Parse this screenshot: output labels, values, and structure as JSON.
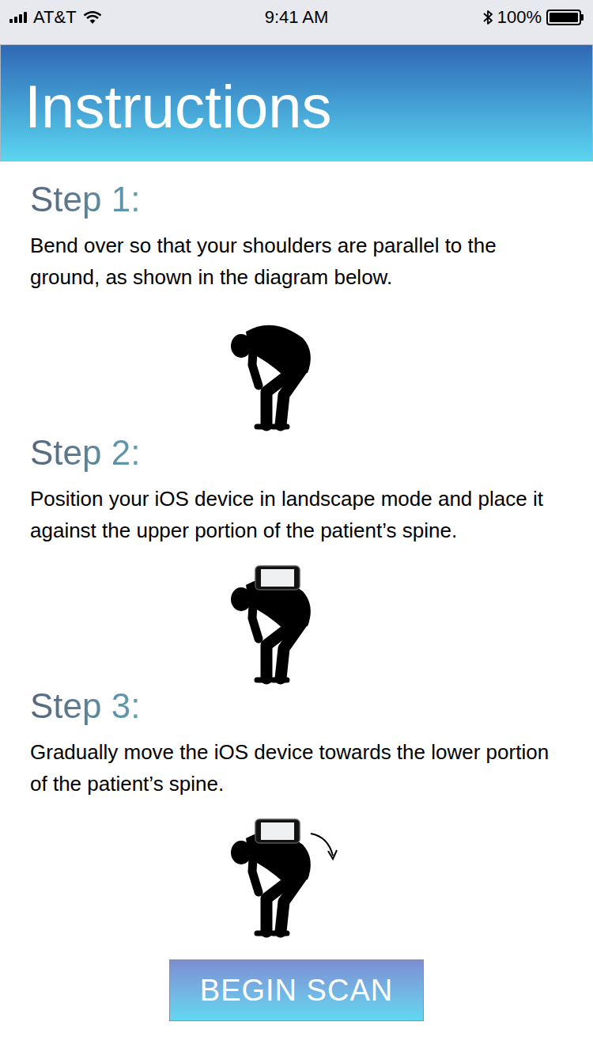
{
  "status_bar": {
    "carrier": "AT&T",
    "signal_level": 1,
    "wifi": true,
    "time": "9:41 AM",
    "bluetooth": true,
    "battery": "100%",
    "battery_level": 1
  },
  "header": {
    "title": "Instructions"
  },
  "steps": [
    {
      "heading": "Step 1:",
      "text": "Bend over so that your shoulders are parallel to the ground, as shown in the diagram below.",
      "kind": "bend"
    },
    {
      "heading": "Step 2:",
      "text": "Position your iOS device in landscape mode and place it against the upper portion of the patient’s spine.",
      "kind": "phone"
    },
    {
      "heading": "Step 3:",
      "text": "Gradually move the iOS device towards the lower portion of the patient’s spine.",
      "kind": "phone-move"
    }
  ],
  "button": "BEGIN SCAN"
}
